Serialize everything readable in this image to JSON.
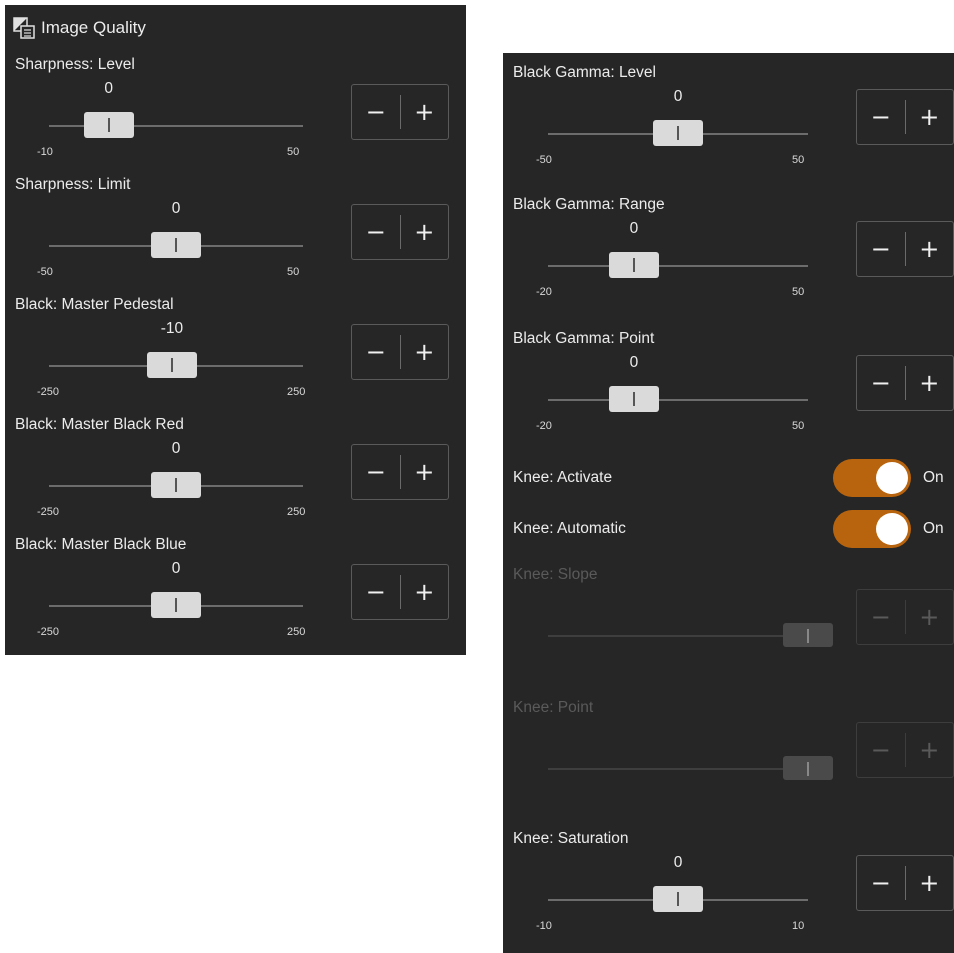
{
  "left_panel": {
    "title": "Image Quality",
    "icon": "image-settings-icon",
    "sliders": [
      {
        "id": "sharpness-level",
        "label": "Sharpness: Level",
        "value": "0",
        "min": "-10",
        "max": "50",
        "position": 0.17
      },
      {
        "id": "sharpness-limit",
        "label": "Sharpness: Limit",
        "value": "0",
        "min": "-50",
        "max": "50",
        "position": 0.5
      },
      {
        "id": "black-master-pedestal",
        "label": "Black: Master Pedestal",
        "value": "-10",
        "min": "-250",
        "max": "250",
        "position": 0.48
      },
      {
        "id": "black-master-black-red",
        "label": "Black: Master Black Red",
        "value": "0",
        "min": "-250",
        "max": "250",
        "position": 0.5
      },
      {
        "id": "black-master-black-blue",
        "label": "Black: Master Black Blue",
        "value": "0",
        "min": "-250",
        "max": "250",
        "position": 0.5
      }
    ]
  },
  "right_panel": {
    "sliders": [
      {
        "id": "black-gamma-level",
        "label": "Black Gamma: Level",
        "value": "0",
        "min": "-50",
        "max": "50",
        "position": 0.5
      },
      {
        "id": "black-gamma-range",
        "label": "Black Gamma: Range",
        "value": "0",
        "min": "-20",
        "max": "50",
        "position": 0.29
      },
      {
        "id": "black-gamma-point",
        "label": "Black Gamma: Point",
        "value": "0",
        "min": "-20",
        "max": "50",
        "position": 0.29
      }
    ],
    "toggles": [
      {
        "id": "knee-activate",
        "label": "Knee: Activate",
        "state": "On",
        "on": true
      },
      {
        "id": "knee-automatic",
        "label": "Knee: Automatic",
        "state": "On",
        "on": true
      }
    ],
    "disabled_sliders": [
      {
        "id": "knee-slope",
        "label": "Knee: Slope",
        "position": 1.0
      },
      {
        "id": "knee-point",
        "label": "Knee: Point",
        "position": 1.0
      }
    ],
    "last_slider": {
      "id": "knee-saturation",
      "label": "Knee: Saturation",
      "value": "0",
      "min": "-10",
      "max": "10",
      "position": 0.5
    }
  },
  "stepper": {
    "minus": "−",
    "plus": "+"
  },
  "colors": {
    "panel_bg": "#262626",
    "toggle_on": "#b8640e",
    "thumb": "#dadada",
    "track": "#6c6c6c"
  }
}
